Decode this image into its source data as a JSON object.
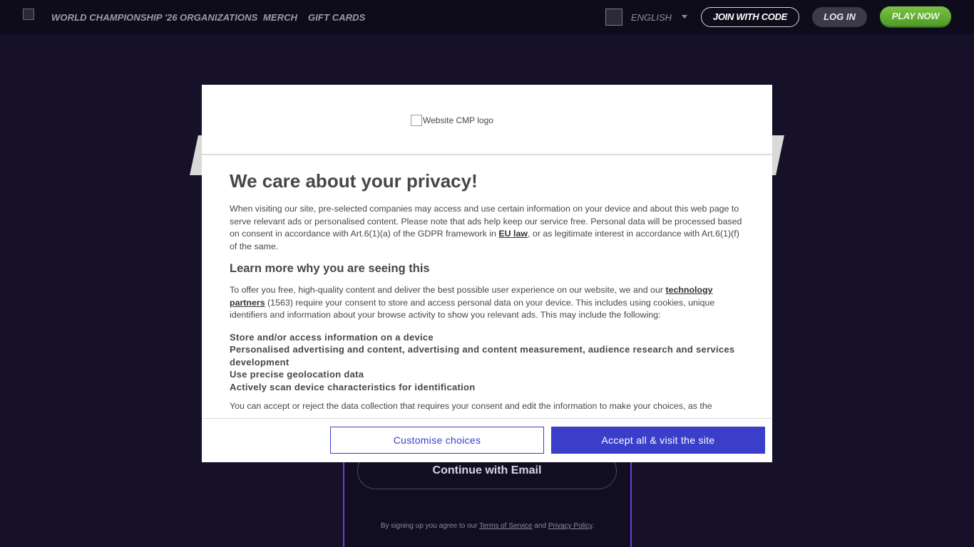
{
  "nav": {
    "links": [
      "WORLD CHAMPIONSHIP '26",
      "ORGANIZATIONS",
      "MERCH",
      "GIFT CARDS"
    ],
    "language": "ENGLISH",
    "join_with_code": "JOIN WITH CODE",
    "log_in": "LOG IN",
    "play_now": "PLAY NOW"
  },
  "signup": {
    "continue_email": "Continue with Email",
    "legal_prefix": "By signing up you agree to our",
    "terms": "Terms of Service",
    "and": "and",
    "privacy": "Privacy Policy",
    "period": "."
  },
  "consent": {
    "logo_alt": "Website CMP logo",
    "title": "We care about your privacy!",
    "intro_pre": "When visiting our site, pre-selected companies may access and use certain information on your device and about this web page to serve relevant ads or personalised content. Please note that ads help keep our service free. Personal data will be processed based on consent in accordance with Art.6(1)(a) of the GDPR framework in",
    "intro_link": "EU law",
    "intro_post": ", or as legitimate interest in accordance with Art.6(1)(f) of the same.",
    "learn_title": "Learn more why you are seeing this",
    "offer_pre": "To offer you free, high-quality content and deliver the best possible user experience on our website, we and our",
    "offer_link": "technology partners",
    "offer_post": "(1563) require your consent to store and access personal data on your device. This includes using cookies, unique identifiers and information about your browse activity to show you relevant ads. This may include the following:",
    "purposes": [
      "Store and/or access information on a device",
      "Personalised advertising and content, advertising and content measurement, audience research and services development",
      "Use precise geolocation data",
      "Actively scan device characteristics for identification"
    ],
    "cut_text": "You can accept or reject the data collection that requires your consent and edit the information to make your choices, as the",
    "customise": "Customise choices",
    "accept": "Accept all & visit the site"
  },
  "colors": {
    "page_bg": "#161129",
    "nav_bg": "#0e0c1a",
    "accent_blue": "#3a3ec8",
    "play_green": "#6ab43a",
    "card_purple": "#6b3fd6"
  }
}
